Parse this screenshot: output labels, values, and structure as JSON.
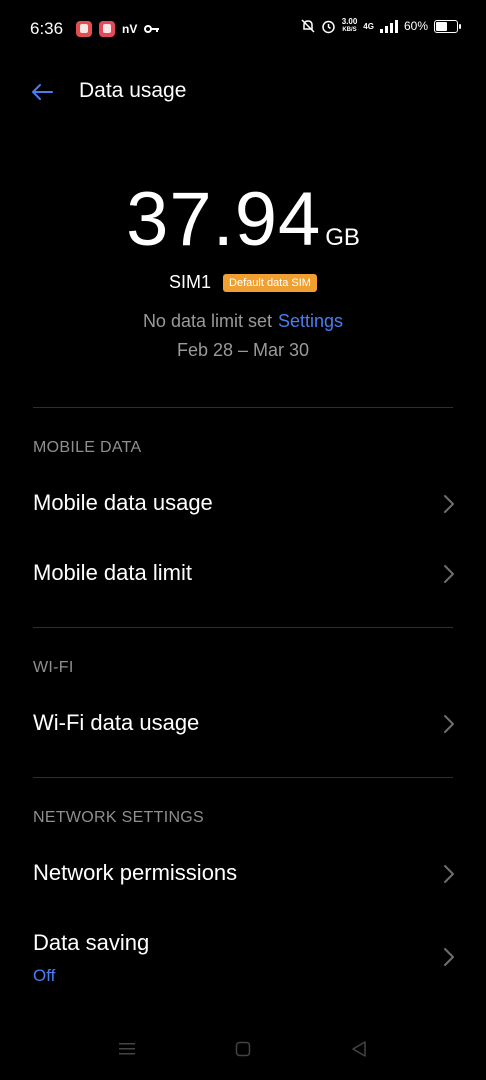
{
  "status_bar": {
    "time": "6:36",
    "carrier_text": "nV",
    "speed_value": "3.00",
    "speed_unit": "KB/S",
    "net_type_top": "4G",
    "battery_text": "60%",
    "battery_level": 60
  },
  "header": {
    "title": "Data usage"
  },
  "usage": {
    "amount": "37.94",
    "unit": "GB",
    "sim": "SIM1",
    "sim_badge": "Default data SIM",
    "limit_text": "No data limit set",
    "limit_link": "Settings",
    "date_range": "Feb 28 – Mar 30"
  },
  "sections": {
    "mobile_data": {
      "header": "MOBILE DATA",
      "items": [
        "Mobile data usage",
        "Mobile data limit"
      ]
    },
    "wifi": {
      "header": "WI-FI",
      "items": [
        "Wi-Fi data usage"
      ]
    },
    "network_settings": {
      "header": "NETWORK SETTINGS",
      "items": [
        "Network permissions",
        "Data saving"
      ],
      "data_saving_value": "Off"
    }
  },
  "colors": {
    "accent": "#4a7ef0",
    "badge": "#f0a030",
    "background": "#000000"
  },
  "icons": [
    "back-arrow-icon",
    "chevron-right-icon",
    "menu-icon",
    "home-icon",
    "back-icon"
  ]
}
